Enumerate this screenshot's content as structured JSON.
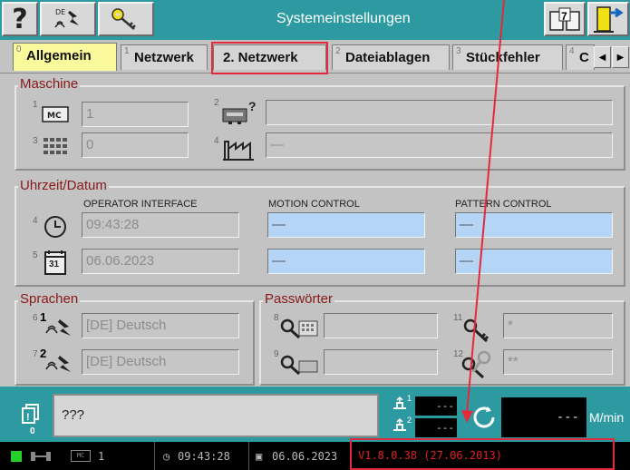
{
  "window": {
    "title": "Systemeinstellungen"
  },
  "toolbar": {
    "help_label": "?",
    "book_number": "7"
  },
  "tabs": [
    {
      "index": "0",
      "label": "Allgemein",
      "active": true
    },
    {
      "index": "1",
      "label": "Netzwerk"
    },
    {
      "index": "",
      "label": "2. Netzwerk",
      "highlighted": true
    },
    {
      "index": "2",
      "label": "Dateiablagen"
    },
    {
      "index": "3",
      "label": "Stückfehler"
    },
    {
      "index": "4",
      "label": "C"
    }
  ],
  "maschine": {
    "title": "Maschine",
    "items": [
      {
        "index": "1",
        "icon": "mc-icon",
        "value": "1"
      },
      {
        "index": "2",
        "icon": "machine-query-icon",
        "value": ""
      },
      {
        "index": "3",
        "icon": "grid-module-icon",
        "value": "0"
      },
      {
        "index": "4",
        "icon": "factory-icon",
        "value": "—"
      }
    ]
  },
  "uhrzeit": {
    "title": "Uhrzeit/Datum",
    "columns": [
      "OPERATOR INTERFACE",
      "MOTION CONTROL",
      "PATTERN CONTROL"
    ],
    "rows": [
      {
        "index": "4",
        "icon": "clock-icon",
        "values": [
          "09:43:28",
          "—",
          "—"
        ]
      },
      {
        "index": "5",
        "icon": "calendar-icon",
        "calendar_day": "31",
        "values": [
          "06.06.2023",
          "—",
          "—"
        ]
      }
    ]
  },
  "sprachen": {
    "title": "Sprachen",
    "items": [
      {
        "index": "6",
        "badge": "1",
        "icon": "language-icon",
        "value": "[DE] Deutsch"
      },
      {
        "index": "7",
        "badge": "2",
        "icon": "language-icon",
        "value": "[DE] Deutsch"
      }
    ]
  },
  "passwoerter": {
    "title": "Passwörter",
    "items": [
      {
        "index": "8",
        "icon": "key-keypad-icon",
        "value": ""
      },
      {
        "index": "11",
        "icon": "key-icon",
        "value": "*"
      },
      {
        "index": "9",
        "icon": "key-card-icon",
        "value": ""
      },
      {
        "index": "12",
        "icon": "keys-icon",
        "value": "**"
      }
    ]
  },
  "status": {
    "message": "???",
    "message_count": "0",
    "counter1_label": "1",
    "counter2_label": "2",
    "counter1": "---",
    "counter2": "---",
    "speed": "---",
    "speed_unit": "M/min"
  },
  "statusbar": {
    "mc_number": "1",
    "time": "09:43:28",
    "date": "06.06.2023",
    "version": "V1.8.0.38 (27.06.2013)"
  },
  "colors": {
    "title_bar": "#2d9aa2",
    "active_tab": "#fafa9c",
    "highlight": "#e32a3c",
    "panel_title": "#8a1818",
    "time_field": "#b4d5f5",
    "version_text": "#e02020"
  }
}
